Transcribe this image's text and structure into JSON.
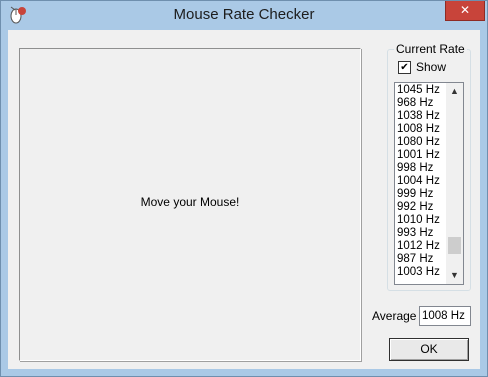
{
  "window": {
    "title": "Mouse Rate Checker",
    "close_label": "✕"
  },
  "mouse_area": {
    "prompt": "Move your Mouse!"
  },
  "current_rate": {
    "group_label": "Current Rate",
    "show_label": "Show",
    "show_checked": true,
    "show_check_glyph": "✔",
    "items": [
      "1045 Hz",
      "968 Hz",
      "1038 Hz",
      "1008 Hz",
      "1080 Hz",
      "1001 Hz",
      "998 Hz",
      "1004 Hz",
      "999 Hz",
      "992 Hz",
      "1010 Hz",
      "993 Hz",
      "1012 Hz",
      "987 Hz",
      "1003 Hz"
    ],
    "scroll_up_glyph": "▲",
    "scroll_down_glyph": "▼"
  },
  "average": {
    "label": "Average",
    "value": "1008 Hz"
  },
  "ok_button": {
    "label": "OK"
  },
  "colors": {
    "frame": "#aac9e6",
    "client": "#f0f0f0",
    "close": "#c8443a"
  }
}
